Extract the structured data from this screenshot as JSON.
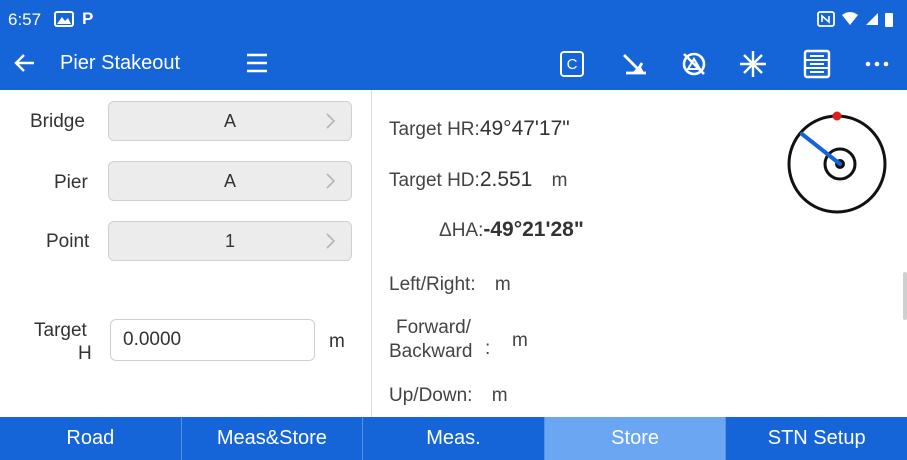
{
  "status_bar": {
    "time": "6:57"
  },
  "app_bar": {
    "title": "Pier Stakeout",
    "c_label": "C"
  },
  "left": {
    "bridge_label": "Bridge",
    "bridge_value": "A",
    "pier_label": "Pier",
    "pier_value": "A",
    "point_label": "Point",
    "point_value": "1",
    "target_h_label_1": "Target",
    "target_h_label_2": "H",
    "target_h_value": "0.0000",
    "target_h_unit": "m"
  },
  "right": {
    "target_hr_label": "Target HR:",
    "target_hr_value": "49°47'17\"",
    "target_hd_label": "Target HD:",
    "target_hd_value": "2.551",
    "target_hd_unit": "m",
    "dha_label": "ΔHA:",
    "dha_value": "-49°21'28\"",
    "left_right_label": "Left/Right:",
    "left_right_unit": "m",
    "forward_label_1": "Forward/",
    "forward_label_2": "Backward",
    "forward_colon": ":",
    "forward_unit": "m",
    "up_down_label": "Up/Down:",
    "up_down_unit": "m"
  },
  "bottom_nav": [
    "Road",
    "Meas&Store",
    "Meas.",
    "Store",
    "STN Setup"
  ],
  "colors": {
    "primary": "#1565d8",
    "active_tab": "#6aa6f2",
    "compass_needle": "#1565d8",
    "compass_north": "#e02020"
  }
}
